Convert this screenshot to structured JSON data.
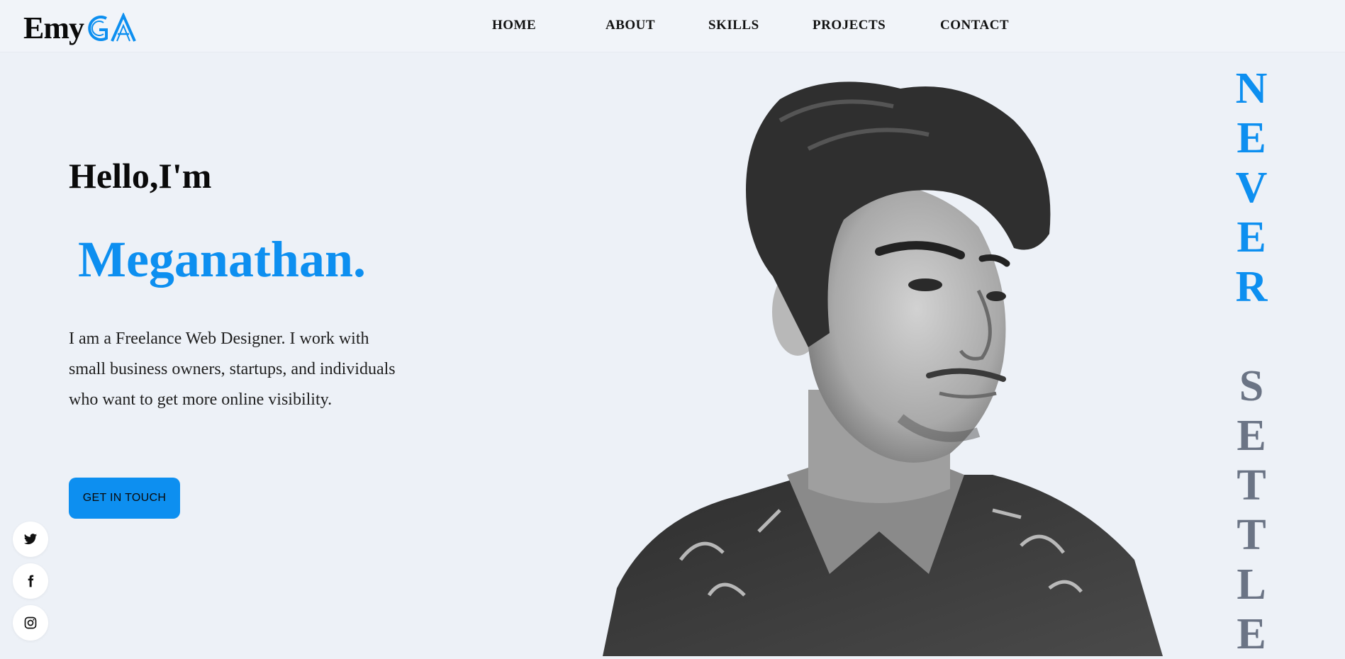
{
  "logo": {
    "text": "Emy",
    "mark_letters": "GA",
    "accent_color": "#0d8ff0"
  },
  "nav": {
    "items": [
      "HOME",
      "ABOUT",
      "SKILLS",
      "PROJECTS",
      "CONTACT"
    ]
  },
  "hero": {
    "greeting": "Hello,I'm",
    "name": "Meganathan.",
    "bio": "I am a Freelance Web Designer. I work with small business owners, startups, and individuals who want to get more online visibility.",
    "cta_label": "GET IN TOUCH"
  },
  "social": [
    {
      "icon": "twitter-icon"
    },
    {
      "icon": "facebook-icon"
    },
    {
      "icon": "instagram-icon"
    }
  ],
  "motto": {
    "word1": [
      "N",
      "E",
      "V",
      "E",
      "R"
    ],
    "word2": [
      "S",
      "E",
      "T",
      "T",
      "L",
      "E"
    ],
    "word1_color": "#0d8ff0",
    "word2_color": "#6b7485"
  },
  "colors": {
    "background": "#edf1f7",
    "header": "#f1f4f9",
    "accent": "#0d8ff0"
  }
}
